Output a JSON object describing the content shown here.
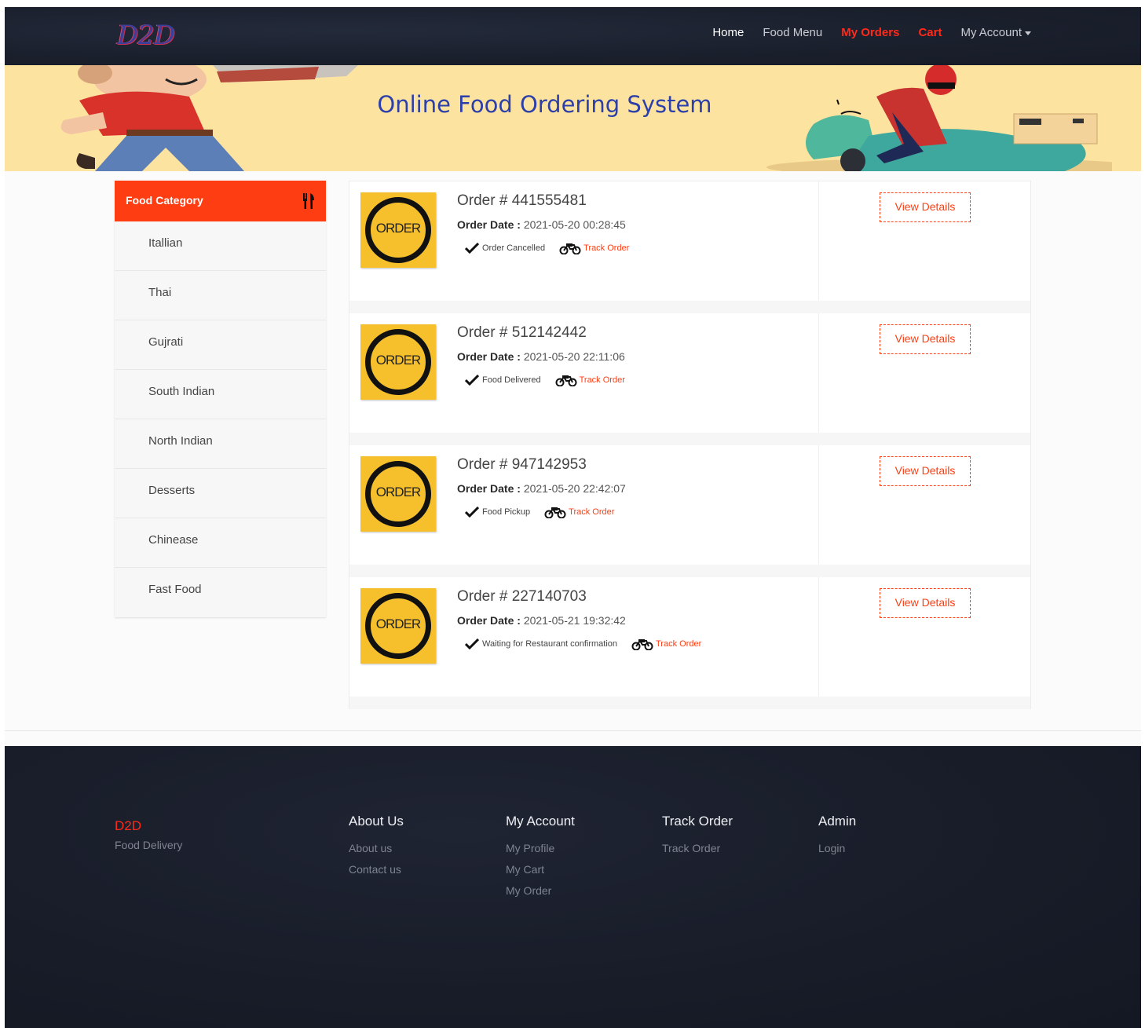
{
  "nav": {
    "logo": "D2D",
    "links": [
      "Home",
      "Food Menu",
      "My Orders",
      "Cart",
      "My Account"
    ]
  },
  "banner": {
    "title": "Online Food Ordering System"
  },
  "sidebar": {
    "header": "Food Category",
    "categories": [
      "Itallian",
      "Thai",
      "Gujrati",
      "South Indian",
      "North Indian",
      "Desserts",
      "Chinease",
      "Fast Food"
    ]
  },
  "orders": [
    {
      "number": "Order # 441555481",
      "date_label": "Order Date :",
      "date": "2021-05-20 00:28:45",
      "status": "Order Cancelled",
      "track": "Track Order",
      "thumb": "ORDER",
      "action": "View Details"
    },
    {
      "number": "Order # 512142442",
      "date_label": "Order Date :",
      "date": "2021-05-20 22:11:06",
      "status": "Food Delivered",
      "track": "Track Order",
      "thumb": "ORDER",
      "action": "View Details"
    },
    {
      "number": "Order # 947142953",
      "date_label": "Order Date :",
      "date": "2021-05-20 22:42:07",
      "status": "Food Pickup",
      "track": "Track Order",
      "thumb": "ORDER",
      "action": "View Details"
    },
    {
      "number": "Order # 227140703",
      "date_label": "Order Date :",
      "date": "2021-05-21 19:32:42",
      "status": "Waiting for Restaurant confirmation",
      "track": "Track Order",
      "thumb": "ORDER",
      "action": "View Details"
    }
  ],
  "footer": {
    "brand": "D2D",
    "tagline": "Food Delivery",
    "columns": [
      {
        "title": "About Us",
        "links": [
          "About us",
          "Contact us"
        ]
      },
      {
        "title": "My Account",
        "links": [
          "My Profile",
          "My Cart",
          "My Order"
        ]
      },
      {
        "title": "Track Order",
        "links": [
          "Track Order"
        ]
      },
      {
        "title": "Admin",
        "links": [
          "Login"
        ]
      }
    ]
  },
  "colors": {
    "accent": "#ff3d12",
    "nav_bg": "#1a1f2c",
    "banner_bg": "#fde3a0",
    "title_blue": "#2d3fa8"
  }
}
